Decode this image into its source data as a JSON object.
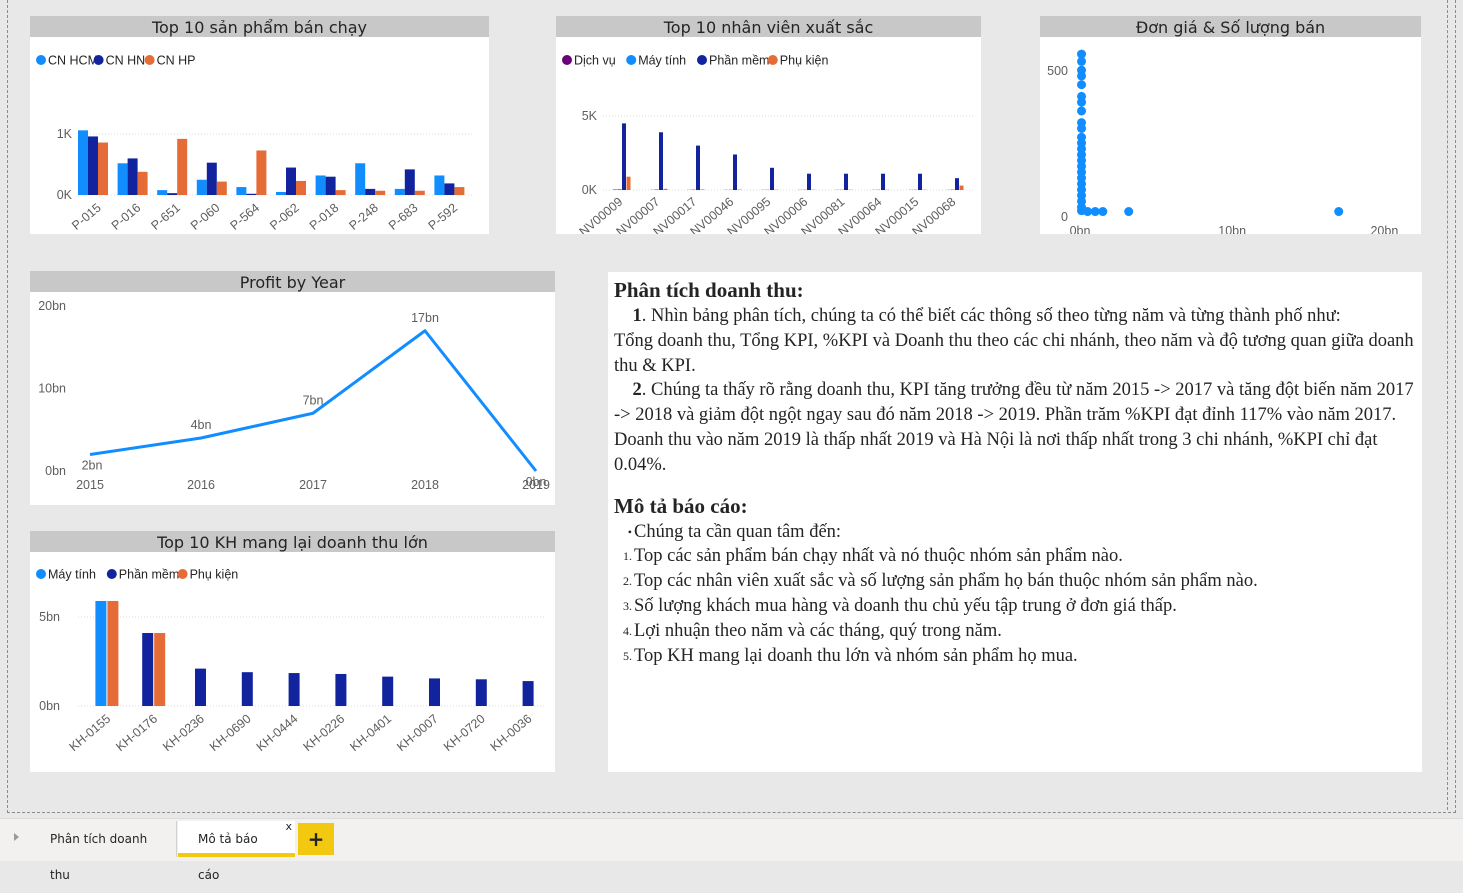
{
  "colors": {
    "blue": "#118DFF",
    "navy": "#12239E",
    "orange": "#E66C37",
    "purple": "#6B007B"
  },
  "tiles": {
    "top_products": {
      "title": "Top 10 sản phẩm bán chạy",
      "legend": [
        "CN HCM",
        "CN HN",
        "CN HP"
      ],
      "y_ticks": [
        "1K",
        "0K"
      ],
      "chart_data": {
        "type": "bar",
        "title": "Top 10 sản phẩm bán chạy",
        "categories": [
          "P-015",
          "P-016",
          "P-651",
          "P-060",
          "P-564",
          "P-062",
          "P-018",
          "P-248",
          "P-683",
          "P-592"
        ],
        "series": [
          {
            "name": "CN HCM",
            "values": [
              1060,
              520,
              80,
              250,
              130,
              50,
              320,
              520,
              100,
              320
            ]
          },
          {
            "name": "CN HN",
            "values": [
              960,
              600,
              30,
              530,
              20,
              450,
              300,
              100,
              420,
              190
            ]
          },
          {
            "name": "CN HP",
            "values": [
              860,
              380,
              920,
              220,
              730,
              230,
              80,
              70,
              70,
              130
            ]
          }
        ],
        "ylim": [
          0,
          1300
        ]
      }
    },
    "top_employees": {
      "title": "Top 10 nhân viên xuất sắc",
      "legend": [
        "Dịch vụ",
        "Máy tính",
        "Phần mềm",
        "Phụ kiện"
      ],
      "y_ticks": [
        "5K",
        "0K"
      ],
      "chart_data": {
        "type": "bar",
        "title": "Top 10 nhân viên xuất sắc",
        "categories": [
          "NV00009",
          "NV00007",
          "NV00017",
          "NV00046",
          "NV00095",
          "NV00006",
          "NV00081",
          "NV00064",
          "NV00015",
          "NV00068"
        ],
        "series": [
          {
            "name": "Dịch vụ",
            "values": [
              30,
              10,
              10,
              10,
              10,
              10,
              10,
              10,
              10,
              10
            ]
          },
          {
            "name": "Máy tính",
            "values": [
              60,
              40,
              30,
              20,
              20,
              20,
              20,
              20,
              20,
              30
            ]
          },
          {
            "name": "Phần mềm",
            "values": [
              4500,
              3900,
              3000,
              2400,
              1500,
              1100,
              1100,
              1100,
              1100,
              800
            ]
          },
          {
            "name": "Phụ kiện",
            "values": [
              900,
              80,
              40,
              30,
              20,
              20,
              20,
              20,
              20,
              300
            ]
          }
        ],
        "ylim": [
          0,
          6500
        ]
      }
    },
    "price_qty": {
      "title": "Đơn giá & Số lượng bán",
      "y_ticks": [
        "500",
        "0"
      ],
      "x_ticks": [
        "0bn",
        "10bn",
        "20bn"
      ],
      "chart_data": {
        "type": "scatter",
        "title": "Đơn giá & Số lượng bán",
        "points": [
          [
            0.1,
            545
          ],
          [
            0.1,
            520
          ],
          [
            0.1,
            490
          ],
          [
            0.1,
            470
          ],
          [
            0.1,
            440
          ],
          [
            0.1,
            400
          ],
          [
            0.1,
            380
          ],
          [
            0.1,
            350
          ],
          [
            0.1,
            310
          ],
          [
            0.1,
            290
          ],
          [
            0.1,
            260
          ],
          [
            0.1,
            240
          ],
          [
            0.1,
            220
          ],
          [
            0.1,
            200
          ],
          [
            0.1,
            180
          ],
          [
            0.1,
            160
          ],
          [
            0.1,
            140
          ],
          [
            0.1,
            120
          ],
          [
            0.1,
            100
          ],
          [
            0.1,
            80
          ],
          [
            0.1,
            60
          ],
          [
            0.1,
            40
          ],
          [
            0.1,
            20
          ],
          [
            0.1,
            8
          ],
          [
            0.5,
            5
          ],
          [
            1.0,
            5
          ],
          [
            1.5,
            5
          ],
          [
            3.2,
            5
          ],
          [
            17.0,
            5
          ]
        ],
        "xlim": [
          0,
          20.5
        ],
        "ylim": [
          0,
          590
        ]
      }
    },
    "profit": {
      "title": "Profit by Year",
      "y_ticks": [
        "20bn",
        "10bn",
        "0bn"
      ],
      "chart_data": {
        "type": "line",
        "title": "Profit by Year",
        "x": [
          "2015",
          "2016",
          "2017",
          "2018",
          "2019"
        ],
        "values": [
          2,
          4,
          7,
          17,
          0
        ],
        "labels": [
          "2bn",
          "4bn",
          "7bn",
          "17bn",
          "0bn"
        ],
        "ylim": [
          0,
          20
        ]
      }
    },
    "top_customers": {
      "title": "Top 10 KH mang lại doanh thu lớn",
      "legend": [
        "Máy tính",
        "Phần mềm",
        "Phụ kiện"
      ],
      "y_ticks": [
        "5bn",
        "0bn"
      ],
      "chart_data": {
        "type": "bar",
        "title": "Top 10 KH mang lại doanh thu lớn",
        "categories": [
          "KH-0155",
          "KH-0176",
          "KH-0236",
          "KH-0690",
          "KH-0444",
          "KH-0226",
          "KH-0401",
          "KH-0007",
          "KH-0720",
          "KH-0036"
        ],
        "series": [
          {
            "name": "Máy tính",
            "values": [
              5.9,
              0,
              0,
              0,
              0,
              0,
              0,
              0,
              0,
              0
            ]
          },
          {
            "name": "Phần mềm",
            "values": [
              0,
              4.1,
              2.1,
              1.9,
              1.85,
              1.8,
              1.65,
              1.55,
              1.5,
              1.4
            ]
          },
          {
            "name": "Phụ kiện",
            "values": [
              5.9,
              4.1,
              0,
              0,
              0,
              0,
              0,
              0,
              0,
              0
            ]
          }
        ],
        "ylim": [
          0,
          7
        ]
      }
    }
  },
  "analysis": {
    "heading1": "Phân tích doanh thu:",
    "p1_num": "1",
    "p1_text": ". Nhìn bảng phân tích, chúng ta có thể biết các thông số theo từng năm và từng thành phố như:",
    "p2": "Tổng doanh thu, Tổng KPI, %KPI và Doanh thu theo các chi nhánh, theo năm và độ tương quan giữa doanh thu & KPI.",
    "p3_num": "2",
    "p3_text": ". Chúng ta thấy rõ rằng doanh thu, KPI tăng trưởng đều từ năm 2015 -> 2017 và tăng đột biến năm 2017 -> 2018 và giảm đột ngột ngay sau đó năm 2018 -> 2019. Phần trăm %KPI đạt đỉnh 117% vào năm 2017.",
    "p4": "Doanh thu vào năm 2019 là thấp nhất 2019 và Hà Nội là nơi thấp nhất trong 3 chi nhánh, %KPI chỉ đạt 0.04%.",
    "heading2": "Mô tả báo cáo:",
    "bullet": "Chúng ta cần quan tâm đến:",
    "items": [
      {
        "marker": "1.",
        "text": "Top các sản phẩm bán chạy nhất và nó thuộc nhóm sản phẩm nào."
      },
      {
        "marker": "2.",
        "text": "Top các nhân viên xuất sắc và số lượng sản phẩm họ bán thuộc nhóm sản phẩm nào."
      },
      {
        "marker": "3.",
        "text": "Số lượng khách mua hàng và doanh thu chủ yếu tập trung ở đơn giá thấp."
      },
      {
        "marker": "4.",
        "text": "Lợi nhuận theo năm và các tháng, quý trong năm."
      },
      {
        "marker": "5.",
        "text": "Top KH mang lại doanh thu lớn và nhóm sản phẩm họ mua."
      }
    ]
  },
  "tabs": {
    "tab1": "Phân tích doanh thu",
    "tab2": "Mô tả báo cáo",
    "close": "x",
    "add": "+"
  }
}
